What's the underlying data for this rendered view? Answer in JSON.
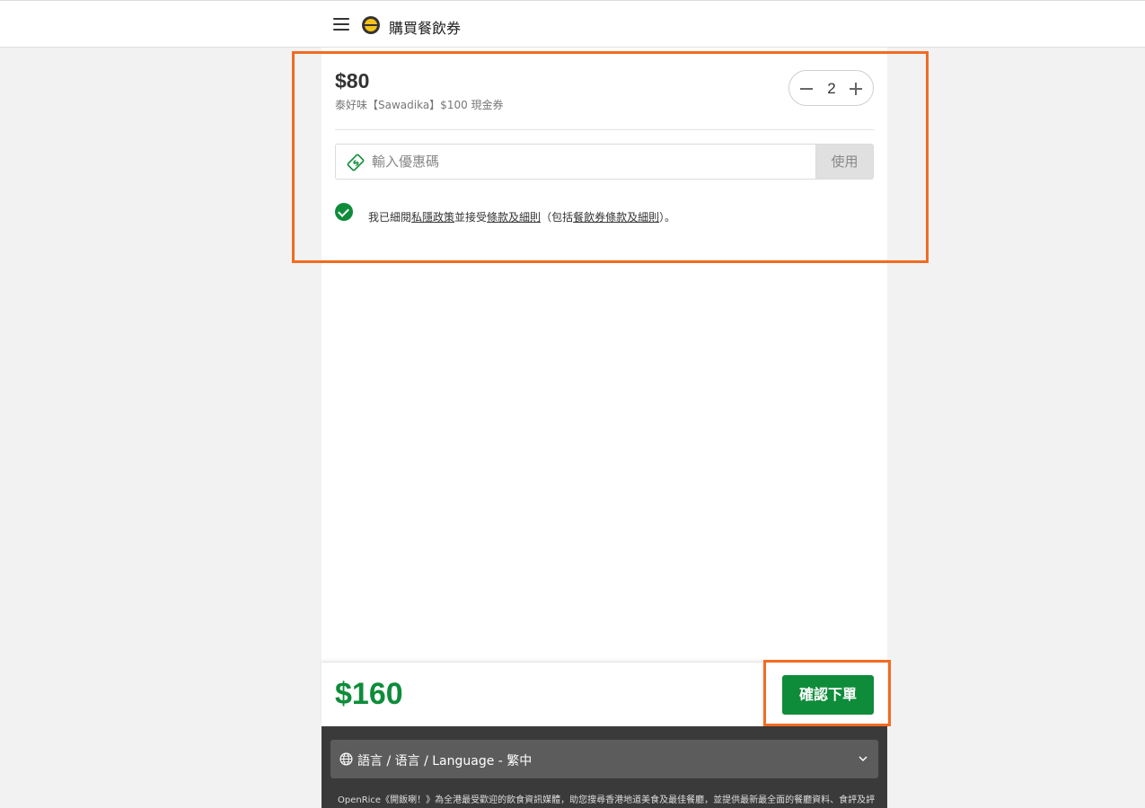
{
  "header": {
    "title": "購買餐飲券",
    "menu_icon": "hamburger-icon",
    "logo_icon": "openrice-logo-icon"
  },
  "voucher": {
    "price": "$80",
    "name": "泰好味【Sawadika】$100 現金券",
    "quantity": "2"
  },
  "coupon": {
    "placeholder": "輸入優惠碼",
    "value": "",
    "apply_label": "使用",
    "icon": "coupon-ticket-icon"
  },
  "terms": {
    "checked": true,
    "part1": "我已細閱",
    "privacy_link": "私隱政策",
    "part2": "並接受",
    "terms_link": "條款及細則",
    "part3": "（包括",
    "voucher_terms_link": "餐飲券條款及細則",
    "part4": "）。"
  },
  "order": {
    "total": "$160",
    "confirm_label": "確認下單"
  },
  "footer": {
    "language_label": "語言 / 语言 / Language - 繁中",
    "description": "OpenRice《開飯喇！》為全港最受歡迎的飲食資訊媒體，助您搜尋香港地道美食及最佳餐廳，並提供最新最全面的餐廳資料、食評及評"
  },
  "colors": {
    "brand_green": "#0e8c3a",
    "highlight_orange": "#f26b21",
    "footer_dark": "#3a3a3a"
  }
}
